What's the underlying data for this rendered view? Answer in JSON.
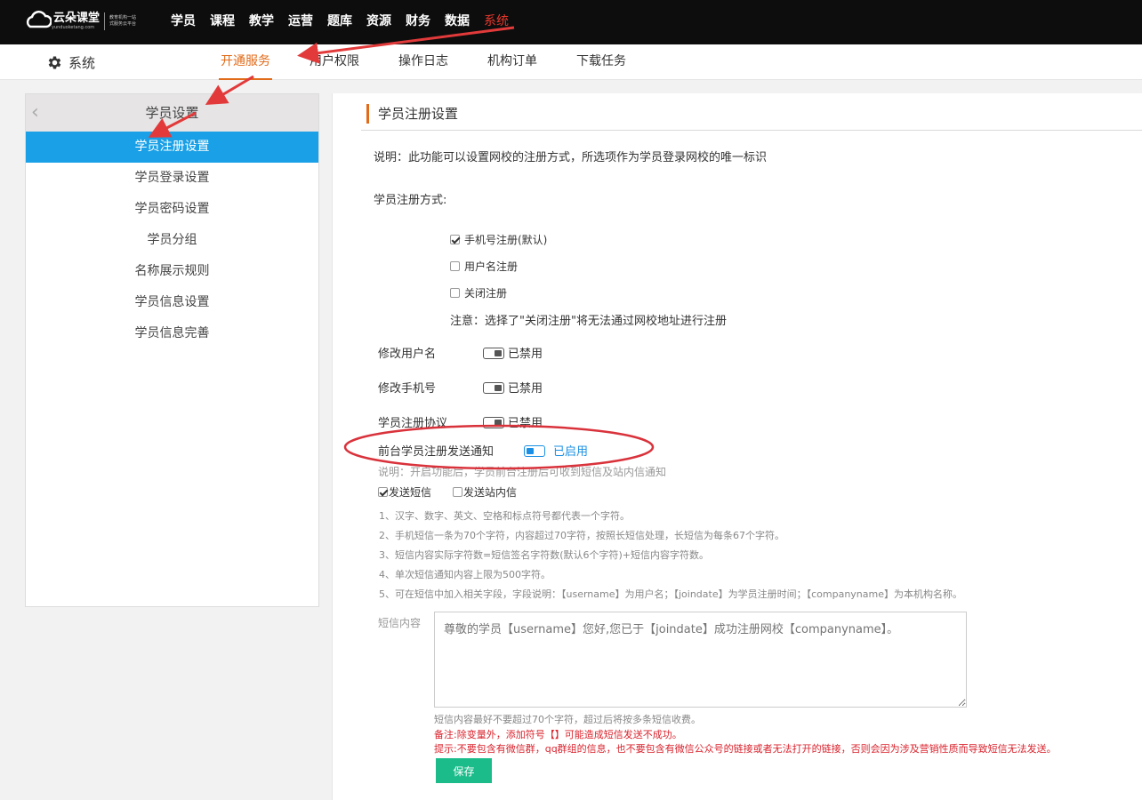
{
  "app": {
    "brand": "云朵课堂",
    "brand_sub": "yunduoketang.com",
    "slogan_line1": "教育机构一站",
    "slogan_line2": "式服务云平台"
  },
  "topnav": {
    "items": [
      "学员",
      "课程",
      "教学",
      "运营",
      "题库",
      "资源",
      "财务",
      "数据",
      "系统"
    ],
    "active": "系统"
  },
  "subbar": {
    "title": "系统",
    "tabs": [
      "开通服务",
      "用户权限",
      "操作日志",
      "机构订单",
      "下载任务"
    ],
    "active_tab": "开通服务"
  },
  "sidebar": {
    "header": "学员设置",
    "items": [
      "学员注册设置",
      "学员登录设置",
      "学员密码设置",
      "学员分组",
      "名称展示规则",
      "学员信息设置",
      "学员信息完善"
    ],
    "active": "学员注册设置"
  },
  "main": {
    "title": "学员注册设置",
    "description": "说明：此功能可以设置网校的注册方式，所选项作为学员登录网校的唯一标识",
    "reg_method_label": "学员注册方式:",
    "options": [
      {
        "label": "手机号注册(默认)",
        "checked": true
      },
      {
        "label": "用户名注册",
        "checked": false
      },
      {
        "label": "关闭注册",
        "checked": false
      }
    ],
    "reg_note": "注意：选择了\"关闭注册\"将无法通过网校地址进行注册",
    "toggles": [
      {
        "label": "修改用户名",
        "status": "已禁用",
        "on": false
      },
      {
        "label": "修改手机号",
        "status": "已禁用",
        "on": false
      },
      {
        "label": "学员注册协议",
        "status": "已禁用",
        "on": false
      },
      {
        "label": "前台学员注册发送通知",
        "status": "已启用",
        "on": true
      }
    ],
    "notify_desc": "说明：开启功能后，学员前台注册后可收到短信及站内信通知",
    "notify_channels": [
      {
        "label": "发送短信",
        "checked": true
      },
      {
        "label": "发送站内信",
        "checked": false
      }
    ],
    "rules": [
      "1、汉字、数字、英文、空格和标点符号都代表一个字符。",
      "2、手机短信一条为70个字符，内容超过70字符，按照长短信处理，长短信为每条67个字符。",
      "3、短信内容实际字符数=短信签名字符数(默认6个字符)+短信内容字符数。",
      "4、单次短信通知内容上限为500字符。",
      "5、可在短信中加入相关字段，字段说明：【username】为用户名；【joindate】为学员注册时间；【companyname】为本机构名称。"
    ],
    "sms_label": "短信内容",
    "sms_placeholder": "尊敬的学员【username】您好,您已于【joindate】成功注册网校【companyname】。",
    "sms_tip": "短信内容最好不要超过70个字符，超过后将按多条短信收费。",
    "remark": "备注:除变量外，添加符号【】可能造成短信发送不成功。",
    "warning": "提示:不要包含有微信群，qq群组的信息，也不要包含有微信公众号的链接或者无法打开的链接，否则会因为涉及营销性质而导致短信无法发送。",
    "save_label": "保存"
  },
  "colors": {
    "accent_orange": "#e26b1a",
    "active_blue": "#1aa0e6",
    "save_green": "#1bbc8a",
    "annotation_red": "#e23a3a"
  }
}
